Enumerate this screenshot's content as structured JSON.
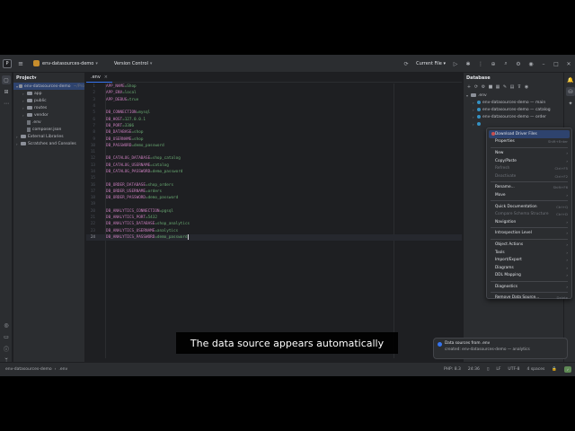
{
  "titlebar": {
    "project_badge": "ED",
    "project_name": "env-datasources-demo",
    "vcs": "Version Control",
    "run_config": "Current File"
  },
  "project_panel": {
    "title": "Project",
    "tree": [
      {
        "label": "env-datasources-demo",
        "tag": "~/Pro",
        "kind": "folder",
        "depth": 0,
        "open": true,
        "selected": true
      },
      {
        "label": "app",
        "kind": "folder",
        "depth": 1
      },
      {
        "label": "public",
        "kind": "folder",
        "depth": 1
      },
      {
        "label": "routes",
        "kind": "folder",
        "depth": 1
      },
      {
        "label": "vendor",
        "kind": "folder",
        "depth": 1
      },
      {
        "label": ".env",
        "kind": "file",
        "depth": 1
      },
      {
        "label": "composer.json",
        "kind": "file",
        "depth": 1
      },
      {
        "label": "External Libraries",
        "kind": "lib",
        "depth": 0
      },
      {
        "label": "Scratches and Consoles",
        "kind": "lib",
        "depth": 0
      }
    ]
  },
  "editor": {
    "tab": ".env",
    "current_line": 24,
    "lines": [
      {
        "n": "1",
        "k": "APP_NAME",
        "v": "=Shop"
      },
      {
        "n": "2",
        "k": "APP_ENV",
        "v": "=local"
      },
      {
        "n": "3",
        "k": "APP_DEBUG",
        "v": "=true"
      },
      {
        "n": "4",
        "k": "",
        "v": ""
      },
      {
        "n": "5",
        "k": "DB_CONNECTION",
        "v": "=mysql"
      },
      {
        "n": "6",
        "k": "DB_HOST",
        "v": "=127.0.0.1"
      },
      {
        "n": "7",
        "k": "DB_PORT",
        "v": "=3306"
      },
      {
        "n": "8",
        "k": "DB_DATABASE",
        "v": "=shop"
      },
      {
        "n": "9",
        "k": "DB_USERNAME",
        "v": "=shop"
      },
      {
        "n": "10",
        "k": "DB_PASSWORD",
        "v": "=demo_password"
      },
      {
        "n": "11",
        "k": "",
        "v": ""
      },
      {
        "n": "12",
        "k": "DB_CATALOG_DATABASE",
        "v": "=shop_catalog"
      },
      {
        "n": "13",
        "k": "DB_CATALOG_USERNAME",
        "v": "=catalog"
      },
      {
        "n": "14",
        "k": "DB_CATALOG_PASSWORD",
        "v": "=demo_password"
      },
      {
        "n": "15",
        "k": "",
        "v": ""
      },
      {
        "n": "16",
        "k": "DB_ORDER_DATABASE",
        "v": "=shop_orders"
      },
      {
        "n": "17",
        "k": "DB_ORDER_USERNAME",
        "v": "=orders"
      },
      {
        "n": "18",
        "k": "DB_ORDER_PASSWORD",
        "v": "=demo_password"
      },
      {
        "n": "19",
        "k": "",
        "v": ""
      },
      {
        "n": "20",
        "k": "DB_ANALYTICS_CONNECTION",
        "v": "=pgsql"
      },
      {
        "n": "21",
        "k": "DB_ANALYTICS_PORT",
        "v": "=5432"
      },
      {
        "n": "22",
        "k": "DB_ANALYTICS_DATABASE",
        "v": "=shop_analytics"
      },
      {
        "n": "23",
        "k": "DB_ANALYTICS_USERNAME",
        "v": "=analytics"
      },
      {
        "n": "24",
        "k": "DB_ANALYTICS_PASSWORD",
        "v": "=demo_password"
      }
    ]
  },
  "database_panel": {
    "title": "Database",
    "tree": [
      {
        "label": ".env",
        "depth": 0,
        "kind": "group"
      },
      {
        "label": "env-datasources-demo — main",
        "depth": 1,
        "kind": "ds"
      },
      {
        "label": "env-datasources-demo — catalog",
        "depth": 1,
        "kind": "ds"
      },
      {
        "label": "env-datasources-demo — order",
        "depth": 1,
        "kind": "ds"
      },
      {
        "label": "",
        "depth": 1,
        "kind": "ds"
      }
    ]
  },
  "context_menu": [
    {
      "label": "Download Driver Files",
      "highlight": true
    },
    {
      "label": "Properties",
      "shortcut": "Shift+Enter"
    },
    {
      "sep": true
    },
    {
      "label": "New",
      "sub": true
    },
    {
      "label": "Copy/Paste",
      "sub": true
    },
    {
      "label": "Refresh",
      "shortcut": "Ctrl+F5",
      "disabled": true
    },
    {
      "label": "Deactivate",
      "shortcut": "Ctrl+F2",
      "disabled": true
    },
    {
      "sep": true
    },
    {
      "label": "Rename...",
      "shortcut": "Shift+F6"
    },
    {
      "label": "Move",
      "sub": true
    },
    {
      "sep": true
    },
    {
      "label": "Quick Documentation",
      "shortcut": "Ctrl+Q"
    },
    {
      "label": "Compare Schema Structure",
      "shortcut": "Ctrl+D",
      "disabled": true
    },
    {
      "label": "Navigation",
      "sub": true
    },
    {
      "sep": true
    },
    {
      "label": "Introspection Level",
      "sub": true
    },
    {
      "sep": true
    },
    {
      "label": "Object Actions",
      "sub": true
    },
    {
      "label": "Tools",
      "sub": true
    },
    {
      "label": "Import/Export",
      "sub": true
    },
    {
      "label": "Diagrams",
      "sub": true
    },
    {
      "label": "DDL Mapping",
      "sub": true
    },
    {
      "sep": true
    },
    {
      "label": "Diagnostics",
      "sub": true
    },
    {
      "sep": true
    },
    {
      "label": "Remove Data Source...",
      "shortcut": "Delete"
    }
  ],
  "notification": {
    "title": "Data sources from .env",
    "body": "created: env-datasources-demo — analytics"
  },
  "statusbar": {
    "crumb_project": "env-datasources-demo",
    "crumb_file": ".env",
    "php": "PHP: 8.3",
    "position": "24:36",
    "line_sep": "LF",
    "encoding": "UTF-8",
    "indent": "4 spaces"
  },
  "caption": "The data source appears automatically",
  "colors": {
    "accent": "#3574f0",
    "bg": "#1e1f22",
    "panel": "#2b2d30",
    "key": "#c77dbb",
    "value": "#6aab73"
  }
}
